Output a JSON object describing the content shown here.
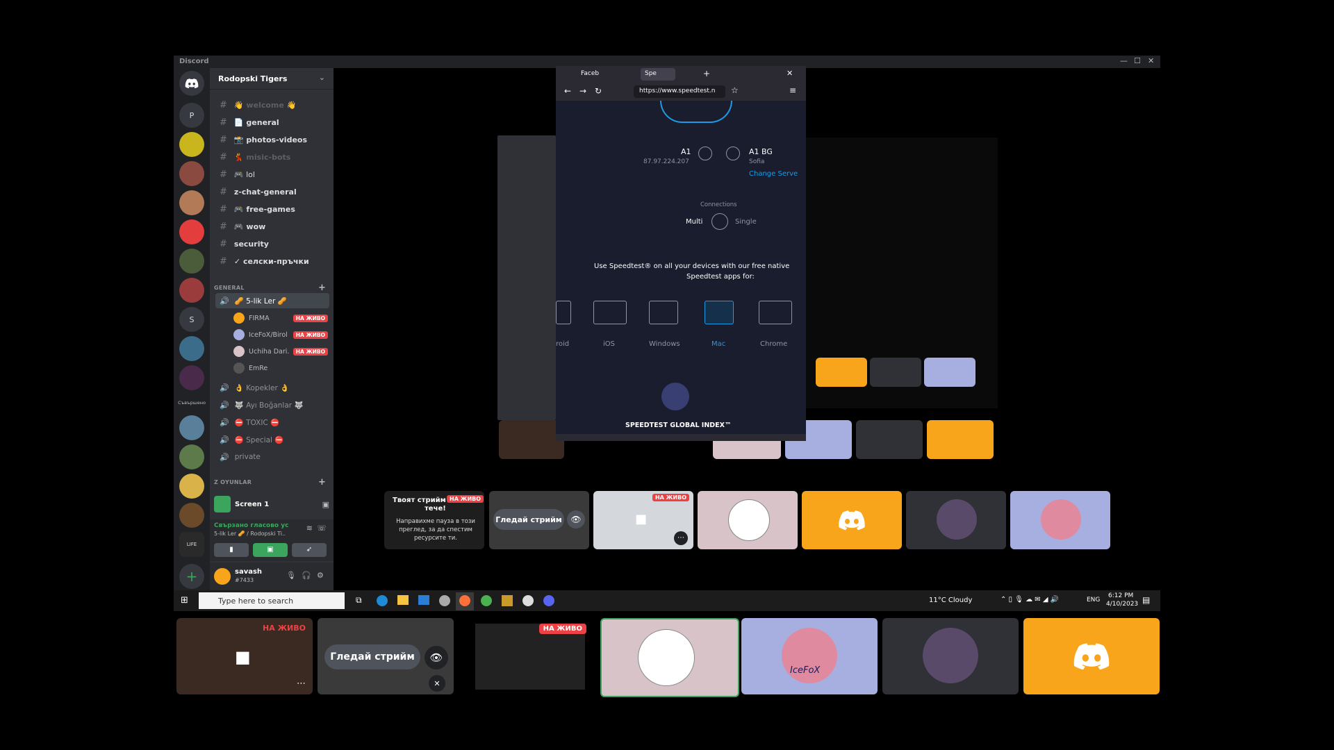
{
  "window": {
    "app_title": "Discord",
    "controls": [
      "—",
      "☐",
      "✕"
    ]
  },
  "guilds": {
    "letters": [
      "P",
      "S"
    ],
    "folder_label": "Съвършено",
    "add_label": "+"
  },
  "server": {
    "name": "Rodopski Tigers",
    "chevron": "⌄"
  },
  "channels": [
    {
      "name": "👋 welcome 👋",
      "muted": true
    },
    {
      "name": "📄 general",
      "muted": false
    },
    {
      "name": "📸 photos-videos",
      "muted": false
    },
    {
      "name": "💃 misic-bots",
      "muted": true
    },
    {
      "name": "🎮 lol",
      "muted": false
    },
    {
      "name": "z-chat-general",
      "muted": false
    },
    {
      "name": "🎮 free-games",
      "muted": false
    },
    {
      "name": "🎮 wow",
      "muted": false
    },
    {
      "name": "security",
      "muted": false
    },
    {
      "name": "✓ селски-пръчки",
      "muted": false
    }
  ],
  "categories": {
    "general": "GENERAL",
    "games": "Z OYUNLAR"
  },
  "voice_channels": [
    {
      "name": "🥜 5-lik Ler 🥜",
      "active": true
    },
    {
      "name": "👌 Kopekler 👌",
      "active": false
    },
    {
      "name": "🐺 Ayı Boğanlar 🐺",
      "active": false
    },
    {
      "name": "⛔ TOXIC ⛔",
      "active": false
    },
    {
      "name": "⛔ Special ⛔",
      "active": false
    },
    {
      "name": "private",
      "active": false
    }
  ],
  "voice_users": [
    {
      "name": "FIRMA",
      "live": "НА ЖИВО"
    },
    {
      "name": "IceFoX/Birol",
      "live": "НА ЖИВО"
    },
    {
      "name": "Uchiha Dari.",
      "live": "НА ЖИВО"
    },
    {
      "name": "EmRe",
      "live": ""
    }
  ],
  "screen_share": {
    "label": "Screen 1"
  },
  "voice_status": {
    "title": "Свързано гласово ус",
    "subtitle": "5-lik Ler 🥜 / Rodopski Ti.."
  },
  "user": {
    "name": "savash",
    "tag": "#7433"
  },
  "browser": {
    "tabs": [
      "Faceb",
      "Spe"
    ],
    "url": "https://www.speedtest.n",
    "isp": "A1",
    "ip": "87.97.224.207",
    "server": "A1 BG",
    "city": "Sofia",
    "change_server": "Change Serve",
    "connections_label": "Connections",
    "multi": "Multi",
    "single": "Single",
    "promo_line1": "Use Speedtest® on all your devices with our free native",
    "promo_line2": "Speedtest apps for:",
    "apps": [
      "roid",
      "iOS",
      "Windows",
      "Mac",
      "Chrome"
    ],
    "index_label": "SPEEDTEST GLOBAL INDEX™"
  },
  "stream_notice": {
    "line1": "Твоят стрийм е",
    "line2": "тече!",
    "body": "Направихме пауза в този преглед, за да спестим ресурсите ти."
  },
  "live_badge": "НА ЖИВО",
  "watch_stream": "Гледай стрийм",
  "icefox_label": "IceFoX",
  "taskbar": {
    "search_placeholder": "Type here to search",
    "weather": "11°C  Cloudy",
    "lang": "ENG",
    "time": "6:12 PM",
    "date": "4/10/2023"
  },
  "colors": {
    "discord_orange": "#f9a51b",
    "live_red": "#ed4245",
    "speedtest_blue": "#1c9ce8",
    "lavender": "#a6afe0",
    "pink_bg": "#d8c4c8"
  }
}
